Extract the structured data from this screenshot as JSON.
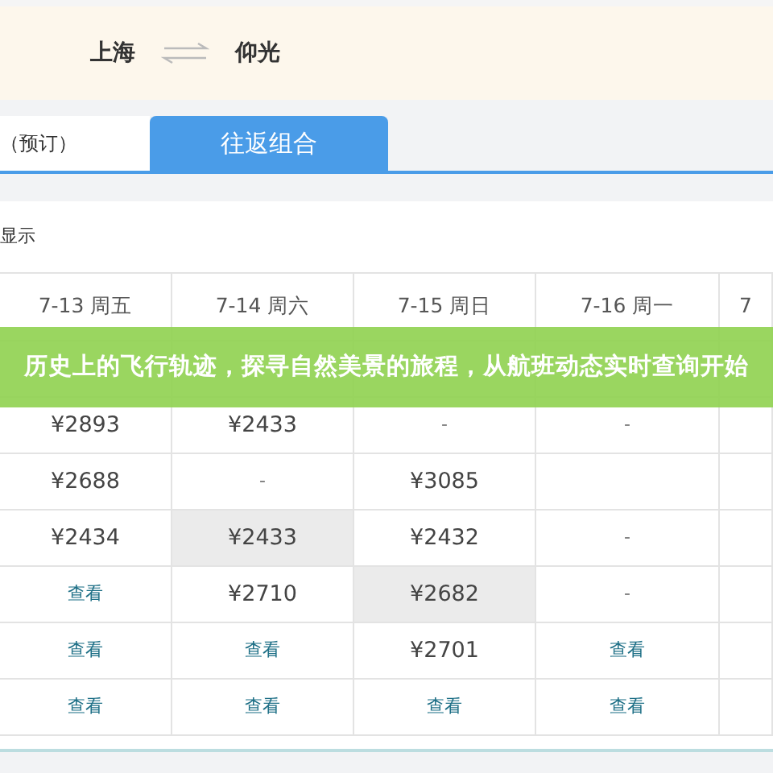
{
  "route": {
    "from": "上海",
    "to": "仰光"
  },
  "tabs": [
    {
      "label": "（预订）",
      "selected": false
    },
    {
      "label": "往返组合",
      "selected": true
    }
  ],
  "display_label": "显示",
  "table": {
    "columns": [
      "7-13 周五",
      "7-14 周六",
      "7-15 周日",
      "7-16 周一",
      "7"
    ],
    "rows": [
      [
        {
          "kind": "empty"
        },
        {
          "kind": "empty"
        },
        {
          "kind": "empty"
        },
        {
          "kind": "empty"
        },
        {
          "kind": "empty"
        }
      ],
      [
        {
          "kind": "price",
          "text": "¥2893",
          "highlighted": false
        },
        {
          "kind": "price",
          "text": "¥2433",
          "highlighted": false
        },
        {
          "kind": "dash",
          "text": "-",
          "highlighted": false
        },
        {
          "kind": "dash",
          "text": "-",
          "highlighted": false
        },
        {
          "kind": "empty"
        }
      ],
      [
        {
          "kind": "price",
          "text": "¥2688",
          "highlighted": false
        },
        {
          "kind": "dash",
          "text": "-",
          "highlighted": false
        },
        {
          "kind": "price",
          "text": "¥3085",
          "highlighted": false
        },
        {
          "kind": "empty"
        },
        {
          "kind": "empty"
        }
      ],
      [
        {
          "kind": "price",
          "text": "¥2434",
          "highlighted": false
        },
        {
          "kind": "price",
          "text": "¥2433",
          "highlighted": true
        },
        {
          "kind": "price",
          "text": "¥2432",
          "highlighted": false
        },
        {
          "kind": "dash",
          "text": "-",
          "highlighted": false
        },
        {
          "kind": "empty"
        }
      ],
      [
        {
          "kind": "link",
          "text": "查看",
          "highlighted": false
        },
        {
          "kind": "price",
          "text": "¥2710",
          "highlighted": false
        },
        {
          "kind": "price",
          "text": "¥2682",
          "highlighted": true
        },
        {
          "kind": "dash",
          "text": "-",
          "highlighted": false
        },
        {
          "kind": "empty"
        }
      ],
      [
        {
          "kind": "link",
          "text": "查看",
          "highlighted": false
        },
        {
          "kind": "link",
          "text": "查看",
          "highlighted": false
        },
        {
          "kind": "price",
          "text": "¥2701",
          "highlighted": false
        },
        {
          "kind": "link",
          "text": "查看",
          "highlighted": false
        },
        {
          "kind": "empty"
        }
      ],
      [
        {
          "kind": "link",
          "text": "查看",
          "highlighted": false
        },
        {
          "kind": "link",
          "text": "查看",
          "highlighted": false
        },
        {
          "kind": "link",
          "text": "查看",
          "highlighted": false
        },
        {
          "kind": "link",
          "text": "查看",
          "highlighted": false
        },
        {
          "kind": "empty"
        }
      ]
    ]
  },
  "banner": {
    "text": "历史上的飞行轨迹，探寻自然美景的旅程，从航班动态实时查询开始"
  }
}
